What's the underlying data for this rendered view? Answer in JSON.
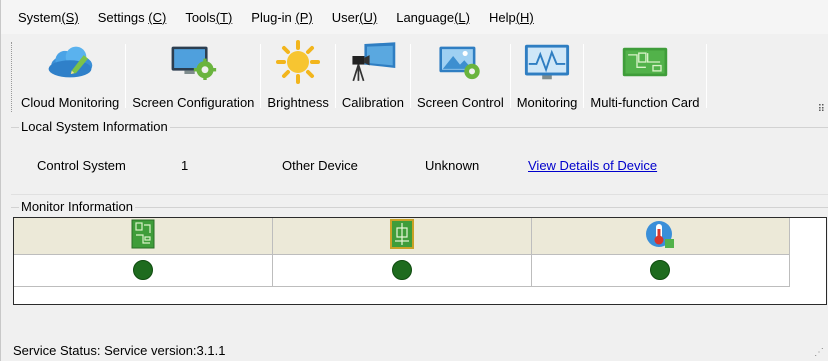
{
  "menu": [
    {
      "label": "System",
      "accel": "(S)"
    },
    {
      "label": "Settings ",
      "accel": "(C)"
    },
    {
      "label": "Tools",
      "accel": "(T)"
    },
    {
      "label": "Plug-in ",
      "accel": "(P)"
    },
    {
      "label": "User",
      "accel": "(U)"
    },
    {
      "label": "Language",
      "accel": "(L)"
    },
    {
      "label": "Help",
      "accel": "(H)"
    }
  ],
  "toolbar": {
    "items": [
      {
        "label": "Cloud Monitoring",
        "icon": "cloud-icon"
      },
      {
        "label": "Screen Configuration",
        "icon": "monitor-gear-icon"
      },
      {
        "label": "Brightness",
        "icon": "sun-icon"
      },
      {
        "label": "Calibration",
        "icon": "camera-tripod-icon"
      },
      {
        "label": "Screen Control",
        "icon": "picture-gear-icon"
      },
      {
        "label": "Monitoring",
        "icon": "waveform-monitor-icon"
      },
      {
        "label": "Multi-function Card",
        "icon": "circuit-board-icon"
      }
    ],
    "more": "⠿"
  },
  "local_system": {
    "title": "Local System Information",
    "control_label": "Control System",
    "control_value": "1",
    "other_label": "Other Device",
    "other_value": "Unknown",
    "details_link": "View Details of Device"
  },
  "monitor": {
    "title": "Monitor Information",
    "columns": [
      {
        "icon": "sending-card-icon",
        "status": "ok"
      },
      {
        "icon": "receiving-card-icon",
        "status": "ok"
      },
      {
        "icon": "thermometer-icon",
        "status": "ok"
      }
    ],
    "status_color": "#1e6b1e"
  },
  "status": {
    "label": "Service Status:",
    "value": "Service version:3.1.1"
  },
  "grip": "⋰"
}
